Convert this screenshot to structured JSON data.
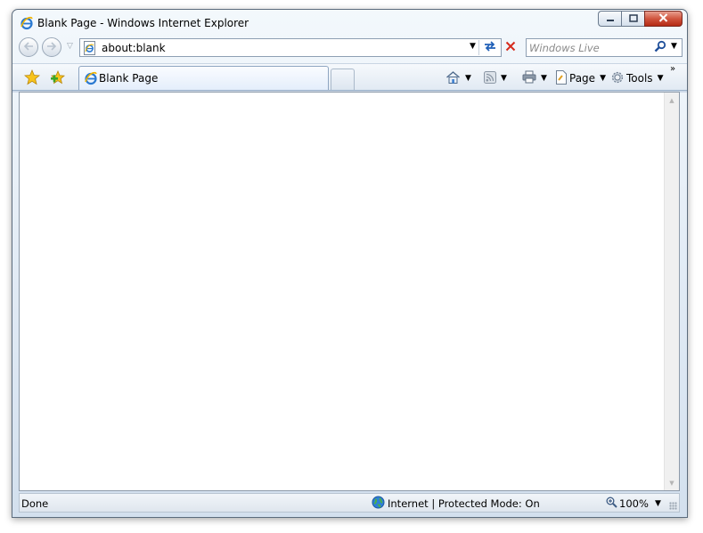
{
  "window": {
    "title": "Blank Page - Windows Internet Explorer",
    "buttons": {
      "minimize": "minimize",
      "maximize": "maximize",
      "close": "close"
    }
  },
  "navigation": {
    "back_icon": "back-arrow-icon",
    "forward_icon": "forward-arrow-icon",
    "recent_pages_icon": "chevron-down-icon"
  },
  "address_bar": {
    "url": "about:blank",
    "page_icon": "ie-page-icon",
    "refresh_icon": "refresh-icon",
    "stop_icon": "stop-x-icon"
  },
  "search": {
    "placeholder": "Windows Live",
    "search_icon": "magnifier-icon"
  },
  "command_bar": {
    "favorites_icon": "star-icon",
    "add_favorites_icon": "add-star-icon",
    "tab_label": "Blank Page",
    "page_label": "Page",
    "tools_label": "Tools",
    "overflow": "»"
  },
  "status_bar": {
    "status": "Done",
    "zone": "Internet | Protected Mode: On",
    "zoom": "100%"
  },
  "colors": {
    "frame": "#dfe9f4",
    "close_button": "#c43a1f",
    "tab_highlight": "#e4eefb",
    "content_background": "#ffffff"
  }
}
